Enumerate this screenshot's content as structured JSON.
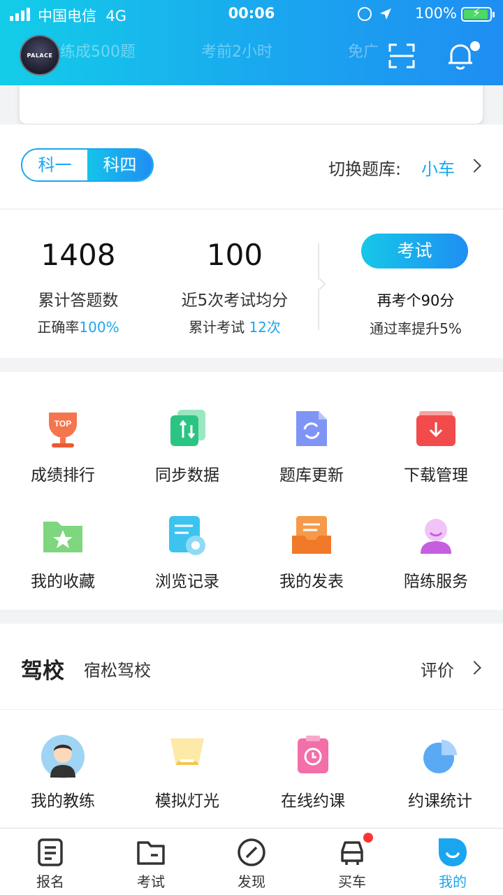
{
  "status_bar": {
    "carrier": "中国电信",
    "network": "4G",
    "time": "00:06",
    "battery": "100%"
  },
  "header": {
    "ghost_cards": [
      "练成500题",
      "考前2小时",
      "免广"
    ]
  },
  "subject_tabs": {
    "tab1": "科一",
    "tab2": "科四",
    "selected": "科四"
  },
  "bank_switch": {
    "label": "切换题库:",
    "value": "小车"
  },
  "stats": {
    "answered_count": "1408",
    "answered_label": "累计答题数",
    "accuracy_label": "正确率",
    "accuracy_value": "100%",
    "avg_score": "100",
    "avg_label": "近5次考试均分",
    "exams_label": "累计考试",
    "exams_value": "12次",
    "exam_button": "考试",
    "retake_text": "再考个90分",
    "improve_text": "通过率提升5%"
  },
  "tools": [
    {
      "label": "成绩排行",
      "icon": "trophy-icon"
    },
    {
      "label": "同步数据",
      "icon": "sync-icon"
    },
    {
      "label": "题库更新",
      "icon": "refresh-doc-icon"
    },
    {
      "label": "下载管理",
      "icon": "download-icon"
    },
    {
      "label": "我的收藏",
      "icon": "favorite-folder-icon"
    },
    {
      "label": "浏览记录",
      "icon": "history-icon"
    },
    {
      "label": "我的发表",
      "icon": "posts-icon"
    },
    {
      "label": "陪练服务",
      "icon": "coach-person-icon"
    }
  ],
  "school": {
    "title": "驾校",
    "name": "宿松驾校",
    "rate": "评价",
    "items": [
      {
        "label": "我的教练",
        "icon": "coach-avatar-icon"
      },
      {
        "label": "模拟灯光",
        "icon": "light-icon"
      },
      {
        "label": "在线约课",
        "icon": "clock-calendar-icon"
      },
      {
        "label": "约课统计",
        "icon": "pie-chart-icon"
      }
    ]
  },
  "tabbar": [
    {
      "label": "报名",
      "icon": "signup-icon"
    },
    {
      "label": "考试",
      "icon": "exam-folder-icon"
    },
    {
      "label": "发现",
      "icon": "compass-icon"
    },
    {
      "label": "买车",
      "icon": "car-icon"
    },
    {
      "label": "我的",
      "icon": "me-icon",
      "active": true
    }
  ],
  "colors": {
    "accent": "#1aa6ef",
    "gradient_start": "#13cde8",
    "gradient_end": "#1f8ef3"
  }
}
